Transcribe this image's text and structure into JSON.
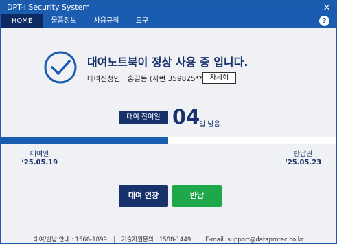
{
  "window": {
    "title": "DPT-i Security System",
    "close_glyph": "×"
  },
  "menu": {
    "items": [
      {
        "label": "HOME",
        "active": true
      },
      {
        "label": "물품정보"
      },
      {
        "label": "사용규칙"
      },
      {
        "label": "도구"
      }
    ],
    "help_glyph": "?"
  },
  "status": {
    "icon": "check-circle-icon",
    "title": "대여노트북이 정상 사용 중 입니다.",
    "renter": "대여신청인 : 홍길동 (사번 359825**)",
    "detail_button": "자세히"
  },
  "remaining": {
    "label": "대여 잔여일",
    "days": "04",
    "unit": "일 남음",
    "elapsed_fraction": 0.5
  },
  "dates": {
    "start_label": "대여일",
    "start_date": "‘25.05.19",
    "end_label": "반납일",
    "end_date": "‘25.05.23"
  },
  "actions": {
    "extend": "대여 연장",
    "return": "반납"
  },
  "footer": {
    "rental_info": "대여/반납 안내 : 1566-1899",
    "tech_support": "기술지원문의 : 1588-1449",
    "email": "E-mail. support@dataprotec.co.kr"
  },
  "colors": {
    "primary": "#1a5cb0",
    "navy": "#17326b",
    "green": "#1ea84a",
    "background": "#f0f1f4"
  }
}
